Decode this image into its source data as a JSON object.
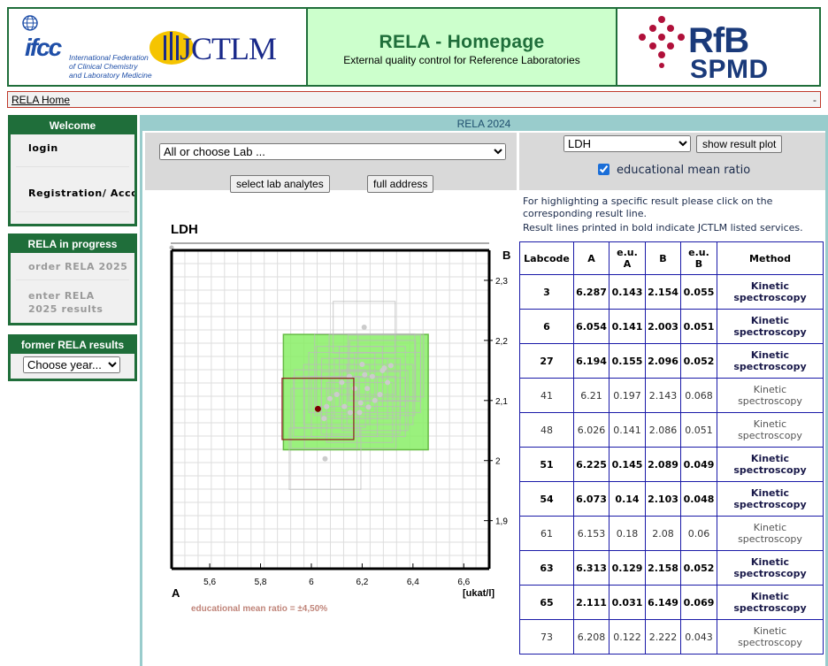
{
  "header": {
    "title": "RELA - Homepage",
    "subtitle": "External quality control for Reference Laboratories",
    "ifcc_logo": {
      "word": "ifcc",
      "line1": "International Federation",
      "line2": "of Clinical Chemistry",
      "line3": "and Laboratory Medicine"
    },
    "jctlm_logo": {
      "text": "JCTLM"
    },
    "rfb_logo": {
      "line1": "RfB",
      "line2": "SPMD"
    }
  },
  "breadcrumb": {
    "home": "RELA Home",
    "trailing": "-"
  },
  "sidebar": {
    "welcome": {
      "title": "Welcome",
      "items": [
        {
          "label": "login"
        },
        {
          "label": "Registration/ Account"
        }
      ]
    },
    "progress": {
      "title": "RELA in progress",
      "items": [
        {
          "label": "order RELA 2025"
        },
        {
          "label": "enter RELA 2025 results"
        }
      ]
    },
    "former": {
      "title": "former RELA results",
      "year_select": "Choose year..."
    }
  },
  "main": {
    "title": "RELA 2024",
    "lab_select": "All or choose Lab ...",
    "select_lab_button": "select lab analytes",
    "full_address_button": "full address",
    "analyte_select": "LDH",
    "show_plot_button": "show result plot",
    "edu_checkbox_label": "educational mean ratio",
    "edu_checked": true,
    "info_text1": "For highlighting a specific result please click on the corresponding result line.",
    "info_text2": "Result lines printed in bold indicate JCTLM listed services."
  },
  "chart_data": {
    "type": "scatter",
    "title": "LDH",
    "xlabel": "A",
    "ylabel": "B",
    "unit_label": "[ukat/l]",
    "caption": "educational mean ratio = ±4,50%",
    "xlim": [
      5.45,
      6.7
    ],
    "ylim": [
      1.82,
      2.35
    ],
    "x_ticks": [
      5.6,
      5.8,
      6.0,
      6.2,
      6.4,
      6.6
    ],
    "x_tick_labels": [
      "5,6",
      "5,8",
      "6",
      "6,2",
      "6,4",
      "6,6"
    ],
    "y_ticks": [
      1.9,
      2.0,
      2.1,
      2.2,
      2.3
    ],
    "y_tick_labels": [
      "1,9",
      "2",
      "2,1",
      "2,2",
      "2,3"
    ],
    "grid": true,
    "colors": {
      "points": "#cccccc",
      "boxes": "#bbbbbb",
      "highlight_point": "#7a0000",
      "highlight_box": "#8b1a1a",
      "target_box_fill": "#88ee66",
      "target_box_stroke": "#66bb44"
    },
    "target_box": {
      "x": [
        5.89,
        6.46
      ],
      "y": [
        2.018,
        2.21
      ]
    },
    "highlight": {
      "x": 6.026,
      "y": 2.086,
      "ux": 0.141,
      "uy": 0.051
    },
    "points": [
      {
        "x": 6.287,
        "y": 2.154,
        "ux": 0.143,
        "uy": 0.055
      },
      {
        "x": 6.054,
        "y": 2.003,
        "ux": 0.141,
        "uy": 0.051
      },
      {
        "x": 6.194,
        "y": 2.096,
        "ux": 0.155,
        "uy": 0.052
      },
      {
        "x": 6.21,
        "y": 2.143,
        "ux": 0.197,
        "uy": 0.068
      },
      {
        "x": 6.225,
        "y": 2.089,
        "ux": 0.145,
        "uy": 0.049
      },
      {
        "x": 6.073,
        "y": 2.103,
        "ux": 0.14,
        "uy": 0.048
      },
      {
        "x": 6.153,
        "y": 2.08,
        "ux": 0.18,
        "uy": 0.06
      },
      {
        "x": 6.313,
        "y": 2.158,
        "ux": 0.129,
        "uy": 0.052
      },
      {
        "x": 6.208,
        "y": 2.222,
        "ux": 0.122,
        "uy": 0.043
      },
      {
        "x": 6.12,
        "y": 2.13,
        "ux": 0.13,
        "uy": 0.05
      },
      {
        "x": 6.17,
        "y": 2.12,
        "ux": 0.13,
        "uy": 0.05
      },
      {
        "x": 6.24,
        "y": 2.14,
        "ux": 0.13,
        "uy": 0.05
      },
      {
        "x": 6.27,
        "y": 2.11,
        "ux": 0.13,
        "uy": 0.05
      },
      {
        "x": 6.1,
        "y": 2.11,
        "ux": 0.13,
        "uy": 0.05
      },
      {
        "x": 6.15,
        "y": 2.14,
        "ux": 0.13,
        "uy": 0.05
      },
      {
        "x": 6.2,
        "y": 2.16,
        "ux": 0.13,
        "uy": 0.05
      },
      {
        "x": 6.3,
        "y": 2.13,
        "ux": 0.13,
        "uy": 0.05
      },
      {
        "x": 6.06,
        "y": 2.09,
        "ux": 0.13,
        "uy": 0.05
      },
      {
        "x": 6.19,
        "y": 2.08,
        "ux": 0.13,
        "uy": 0.05
      },
      {
        "x": 6.25,
        "y": 2.1,
        "ux": 0.13,
        "uy": 0.05
      },
      {
        "x": 6.13,
        "y": 2.09,
        "ux": 0.13,
        "uy": 0.05
      },
      {
        "x": 6.28,
        "y": 2.15,
        "ux": 0.13,
        "uy": 0.05
      },
      {
        "x": 6.22,
        "y": 2.12,
        "ux": 0.13,
        "uy": 0.05
      },
      {
        "x": 6.05,
        "y": 2.07,
        "ux": 0.13,
        "uy": 0.05
      }
    ]
  },
  "results_table": {
    "headers": [
      {
        "line1": "Labcode",
        "line2": ""
      },
      {
        "line1": "A",
        "line2": ""
      },
      {
        "line1": "e.u.",
        "line2": "A"
      },
      {
        "line1": "B",
        "line2": ""
      },
      {
        "line1": "e.u.",
        "line2": "B"
      },
      {
        "line1": "Method",
        "line2": ""
      }
    ],
    "rows": [
      {
        "labcode": "3",
        "a": "6.287",
        "eua": "0.143",
        "b": "2.154",
        "eub": "0.055",
        "method1": "Kinetic",
        "method2": "spectroscopy",
        "bold": true
      },
      {
        "labcode": "6",
        "a": "6.054",
        "eua": "0.141",
        "b": "2.003",
        "eub": "0.051",
        "method1": "Kinetic",
        "method2": "spectroscopy",
        "bold": true
      },
      {
        "labcode": "27",
        "a": "6.194",
        "eua": "0.155",
        "b": "2.096",
        "eub": "0.052",
        "method1": "Kinetic",
        "method2": "spectroscopy",
        "bold": true
      },
      {
        "labcode": "41",
        "a": "6.21",
        "eua": "0.197",
        "b": "2.143",
        "eub": "0.068",
        "method1": "Kinetic",
        "method2": "spectroscopy",
        "bold": false
      },
      {
        "labcode": "48",
        "a": "6.026",
        "eua": "0.141",
        "b": "2.086",
        "eub": "0.051",
        "method1": "Kinetic",
        "method2": "spectroscopy",
        "bold": false
      },
      {
        "labcode": "51",
        "a": "6.225",
        "eua": "0.145",
        "b": "2.089",
        "eub": "0.049",
        "method1": "Kinetic",
        "method2": "spectroscopy",
        "bold": true
      },
      {
        "labcode": "54",
        "a": "6.073",
        "eua": "0.14",
        "b": "2.103",
        "eub": "0.048",
        "method1": "Kinetic",
        "method2": "spectroscopy",
        "bold": true
      },
      {
        "labcode": "61",
        "a": "6.153",
        "eua": "0.18",
        "b": "2.08",
        "eub": "0.06",
        "method1": "Kinetic",
        "method2": "spectroscopy",
        "bold": false
      },
      {
        "labcode": "63",
        "a": "6.313",
        "eua": "0.129",
        "b": "2.158",
        "eub": "0.052",
        "method1": "Kinetic",
        "method2": "spectroscopy",
        "bold": true
      },
      {
        "labcode": "65",
        "a": "2.111",
        "eua": "0.031",
        "b": "6.149",
        "eub": "0.069",
        "method1": "Kinetic",
        "method2": "spectroscopy",
        "bold": true
      },
      {
        "labcode": "73",
        "a": "6.208",
        "eua": "0.122",
        "b": "2.222",
        "eub": "0.043",
        "method1": "Kinetic",
        "method2": "spectroscopy",
        "bold": false
      }
    ]
  }
}
